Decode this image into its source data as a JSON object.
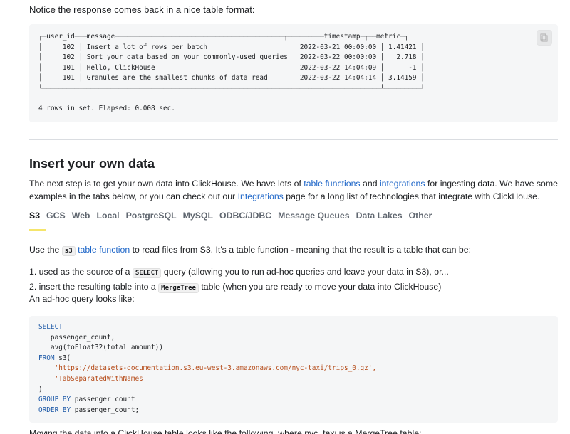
{
  "intro_text": "Notice the response comes back in a nice table format:",
  "result": {
    "table_text": "┌─user_id─┬─message──────────────────────────────────────────┬─────────timestamp─┬──metric─┐\n│     102 │ Insert a lot of rows per batch                     │ 2022-03-21 00:00:00 │ 1.41421 │\n│     102 │ Sort your data based on your commonly-used queries │ 2022-03-22 00:00:00 │   2.718 │\n│     101 │ Hello, ClickHouse!                                 │ 2022-03-22 14:04:09 │      -1 │\n│     101 │ Granules are the smallest chunks of data read      │ 2022-03-22 14:04:14 │ 3.14159 │\n└─────────┴────────────────────────────────────────────────────┴─────────────────────┴─────────┘",
    "rows_text": "4 rows in set. Elapsed: 0.008 sec."
  },
  "section": {
    "title": "Insert your own data",
    "p1_part1": "The next step is to get your own data into ClickHouse. We have lots of ",
    "p1_link1": "table functions",
    "p1_part2": " and ",
    "p1_link2": "integrations",
    "p1_part3": " for ingesting data. We have some examples in the tabs below, or you can check out our ",
    "p1_link3": "Integrations",
    "p1_part4": " page for a long list of technologies that integrate with ClickHouse."
  },
  "tabs": [
    "S3",
    "GCS",
    "Web",
    "Local",
    "PostgreSQL",
    "MySQL",
    "ODBC/JDBC",
    "Message Queues",
    "Data Lakes",
    "Other"
  ],
  "use_para": {
    "part1": "Use the ",
    "code": "s3",
    "link": "table function",
    "part2": " to read files from S3. It's a table function - meaning that the result is a table that can be:"
  },
  "list": {
    "item1_prefix": "1. used as the source of a ",
    "item1_code": "SELECT",
    "item1_suffix": " query (allowing you to run ad-hoc queries and leave your data in S3), or...",
    "item2_prefix": "2. insert the resulting table into a ",
    "item2_code": "MergeTree",
    "item2_suffix": " table (when you are ready to move your data into ClickHouse)"
  },
  "adhoc_text": "An ad-hoc query looks like:",
  "sql": {
    "select": "SELECT",
    "line2": "   passenger_count,",
    "line3": "   avg(toFloat32(total_amount))",
    "from": "FROM",
    "line4_rest": " s3(",
    "line5": "'https://datasets-documentation.s3.eu-west-3.amazonaws.com/nyc-taxi/trips_0.gz',",
    "line6": "'TabSeparatedWithNames'",
    "line7": ")",
    "group_by": "GROUP BY",
    "line8_rest": " passenger_count",
    "order_by": "ORDER BY",
    "line9_rest": " passenger_count;"
  },
  "cut_text": "Moving the data into a ClickHouse table looks like the following, where nyc_taxi is a MergeTree table:"
}
